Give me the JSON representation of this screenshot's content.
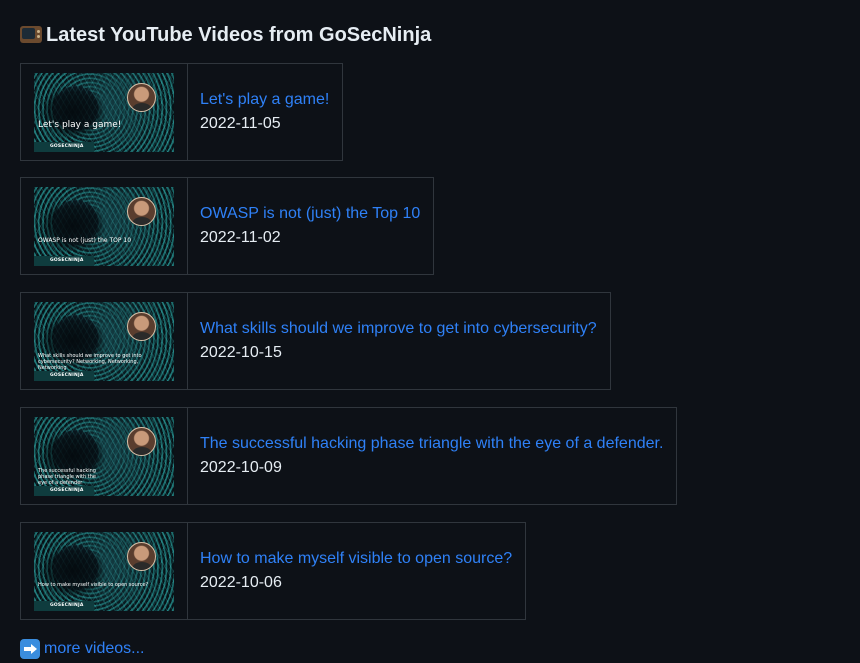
{
  "heading": {
    "icon": "television-icon",
    "text": "Latest YouTube Videos from GoSecNinja"
  },
  "videos": [
    {
      "title": "Let's play a game!",
      "date": "2022-11-05",
      "thumbnail_caption": "Let's play a game!",
      "thumbnail_brand": "GOSECNINJA"
    },
    {
      "title": "OWASP is not (just) the Top 10",
      "date": "2022-11-02",
      "thumbnail_caption": "OWASP is not (just) the TOP 10",
      "thumbnail_brand": "GOSECNINJA"
    },
    {
      "title": "What skills should we improve to get into cybersecurity?",
      "date": "2022-10-15",
      "thumbnail_caption": "What skills should we improve to get into cybersecurity? Networking, Networking, Networking",
      "thumbnail_brand": "GOSECNINJA"
    },
    {
      "title": "The successful hacking phase triangle with the eye of a defender.",
      "date": "2022-10-09",
      "thumbnail_caption": "The successful hacking phase triangle with the eye of a defender",
      "thumbnail_brand": "GOSECNINJA"
    },
    {
      "title": "How to make myself visible to open source?",
      "date": "2022-10-06",
      "thumbnail_caption": "How to make myself visible to open source?",
      "thumbnail_brand": "GOSECNINJA"
    }
  ],
  "more": {
    "icon": "right-arrow-icon",
    "label": "more videos..."
  },
  "colors": {
    "background": "#0d1117",
    "link": "#2f81f7",
    "text": "#e6edf3",
    "border": "#30363d"
  }
}
